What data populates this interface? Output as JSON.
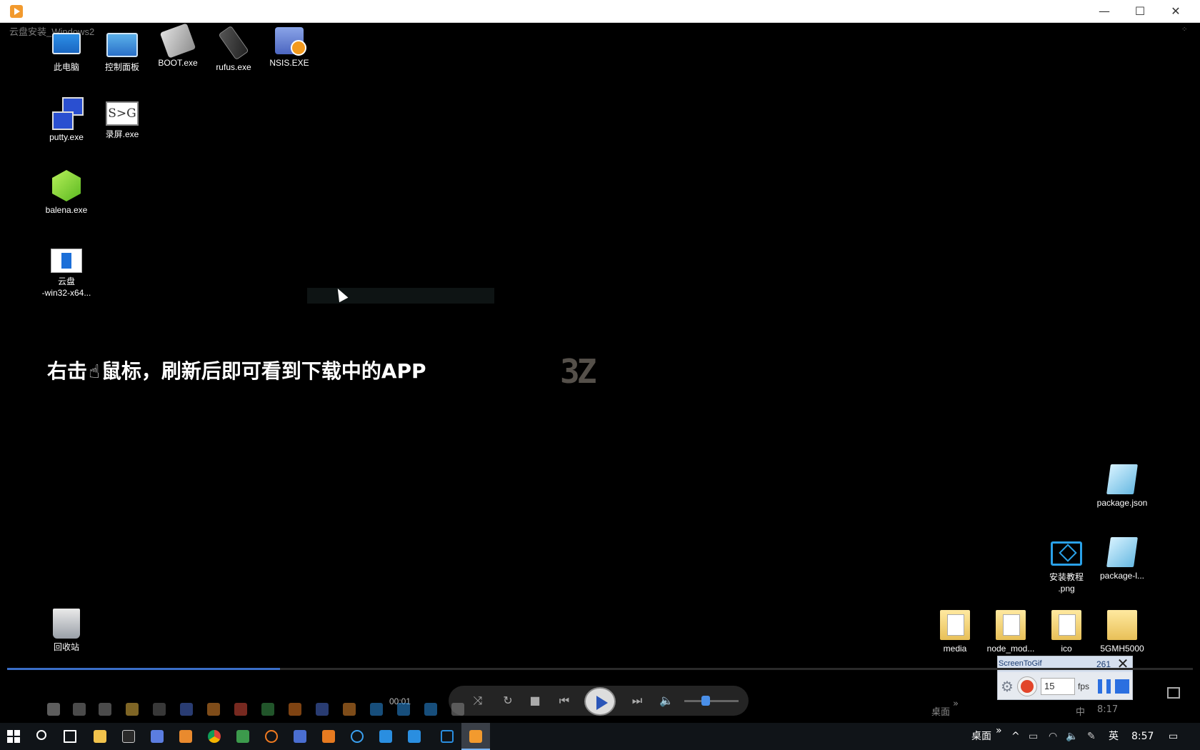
{
  "window": {
    "minimize": "—",
    "maximize": "☐",
    "close": "✕"
  },
  "video": {
    "title": "云盘安装_Windows2",
    "caption_part1": "右击",
    "caption_hand": "☝",
    "caption_part2": "鼠标，刷新后即可看到下载中的APP",
    "watermark": "3Z"
  },
  "desktop_icons": {
    "this_pc": "此电脑",
    "control_panel": "控制面板",
    "boot": "BOOT.exe",
    "rufus": "rufus.exe",
    "nsis": "NSIS.EXE",
    "putty": "putty.exe",
    "screen_rec": "录屏.exe",
    "screen_rec_glyph": "S>G",
    "balena": "balena.exe",
    "cloud_line1": "云盘",
    "cloud_line2": "-win32-x64...",
    "recycle": "回收站",
    "package_json": "package.json",
    "tutorial_line1": "安装教程",
    "tutorial_line2": ".png",
    "package_lock": "package-l...",
    "media": "media",
    "node_modules": "node_mod...",
    "ico": "ico",
    "gmh": "5GMH5000"
  },
  "recorder": {
    "name": "ScreenToGif",
    "frames": "261",
    "fps_value": "15",
    "fps_label": "fps",
    "close": "✕",
    "colors": {
      "record": "#e2452a",
      "accent": "#2b6fe0"
    }
  },
  "player": {
    "time": "00:01",
    "progress": 0.23,
    "volume": 0.4,
    "buttons": {
      "shuffle": "⤨",
      "repeat": "↻",
      "stop": "■",
      "prev": "⏮",
      "next": "⏭",
      "volume": "🔈"
    }
  },
  "recorded_tray": {
    "desktop": "桌面",
    "chevron": "»",
    "ime": "中",
    "clock": "8:17"
  },
  "taskbar": {
    "desktop": "桌面",
    "chevron": "»",
    "ime": "英",
    "clock": "8:57",
    "up_arrow": "^",
    "notification_icon": "▭"
  }
}
